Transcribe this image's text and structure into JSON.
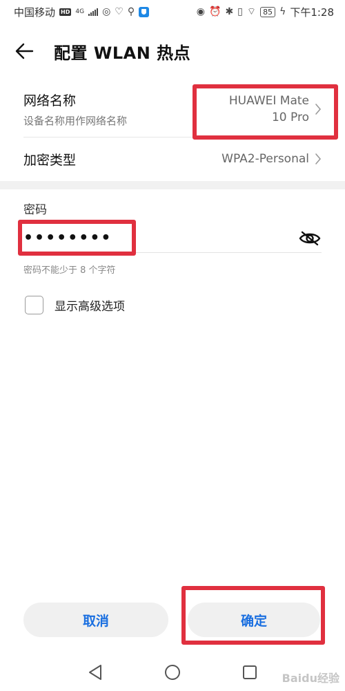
{
  "status_bar": {
    "carrier": "中国移动",
    "hd": "HD",
    "network": "4G",
    "battery": "85",
    "time": "下午1:28"
  },
  "header": {
    "title": "配置 WLAN 热点",
    "back_icon": "back-arrow-icon"
  },
  "ssid": {
    "title": "网络名称",
    "subtitle": "设备名称用作网络名称",
    "value_line1": "HUAWEI Mate",
    "value_line2": "10 Pro"
  },
  "security": {
    "title": "加密类型",
    "value": "WPA2-Personal"
  },
  "password": {
    "label": "密码",
    "value": "••••••••",
    "hint": "密码不能少于 8 个字符",
    "toggle_icon": "eye-slash-icon"
  },
  "advanced": {
    "label": "显示高级选项",
    "checked": false
  },
  "buttons": {
    "cancel": "取消",
    "ok": "确定"
  },
  "nav": {
    "back": "nav-back-icon",
    "home": "nav-home-icon",
    "recents": "nav-recents-icon"
  },
  "watermark": "Baidu经验",
  "colors": {
    "accent": "#1a6fe0",
    "highlight": "#e0303f"
  }
}
